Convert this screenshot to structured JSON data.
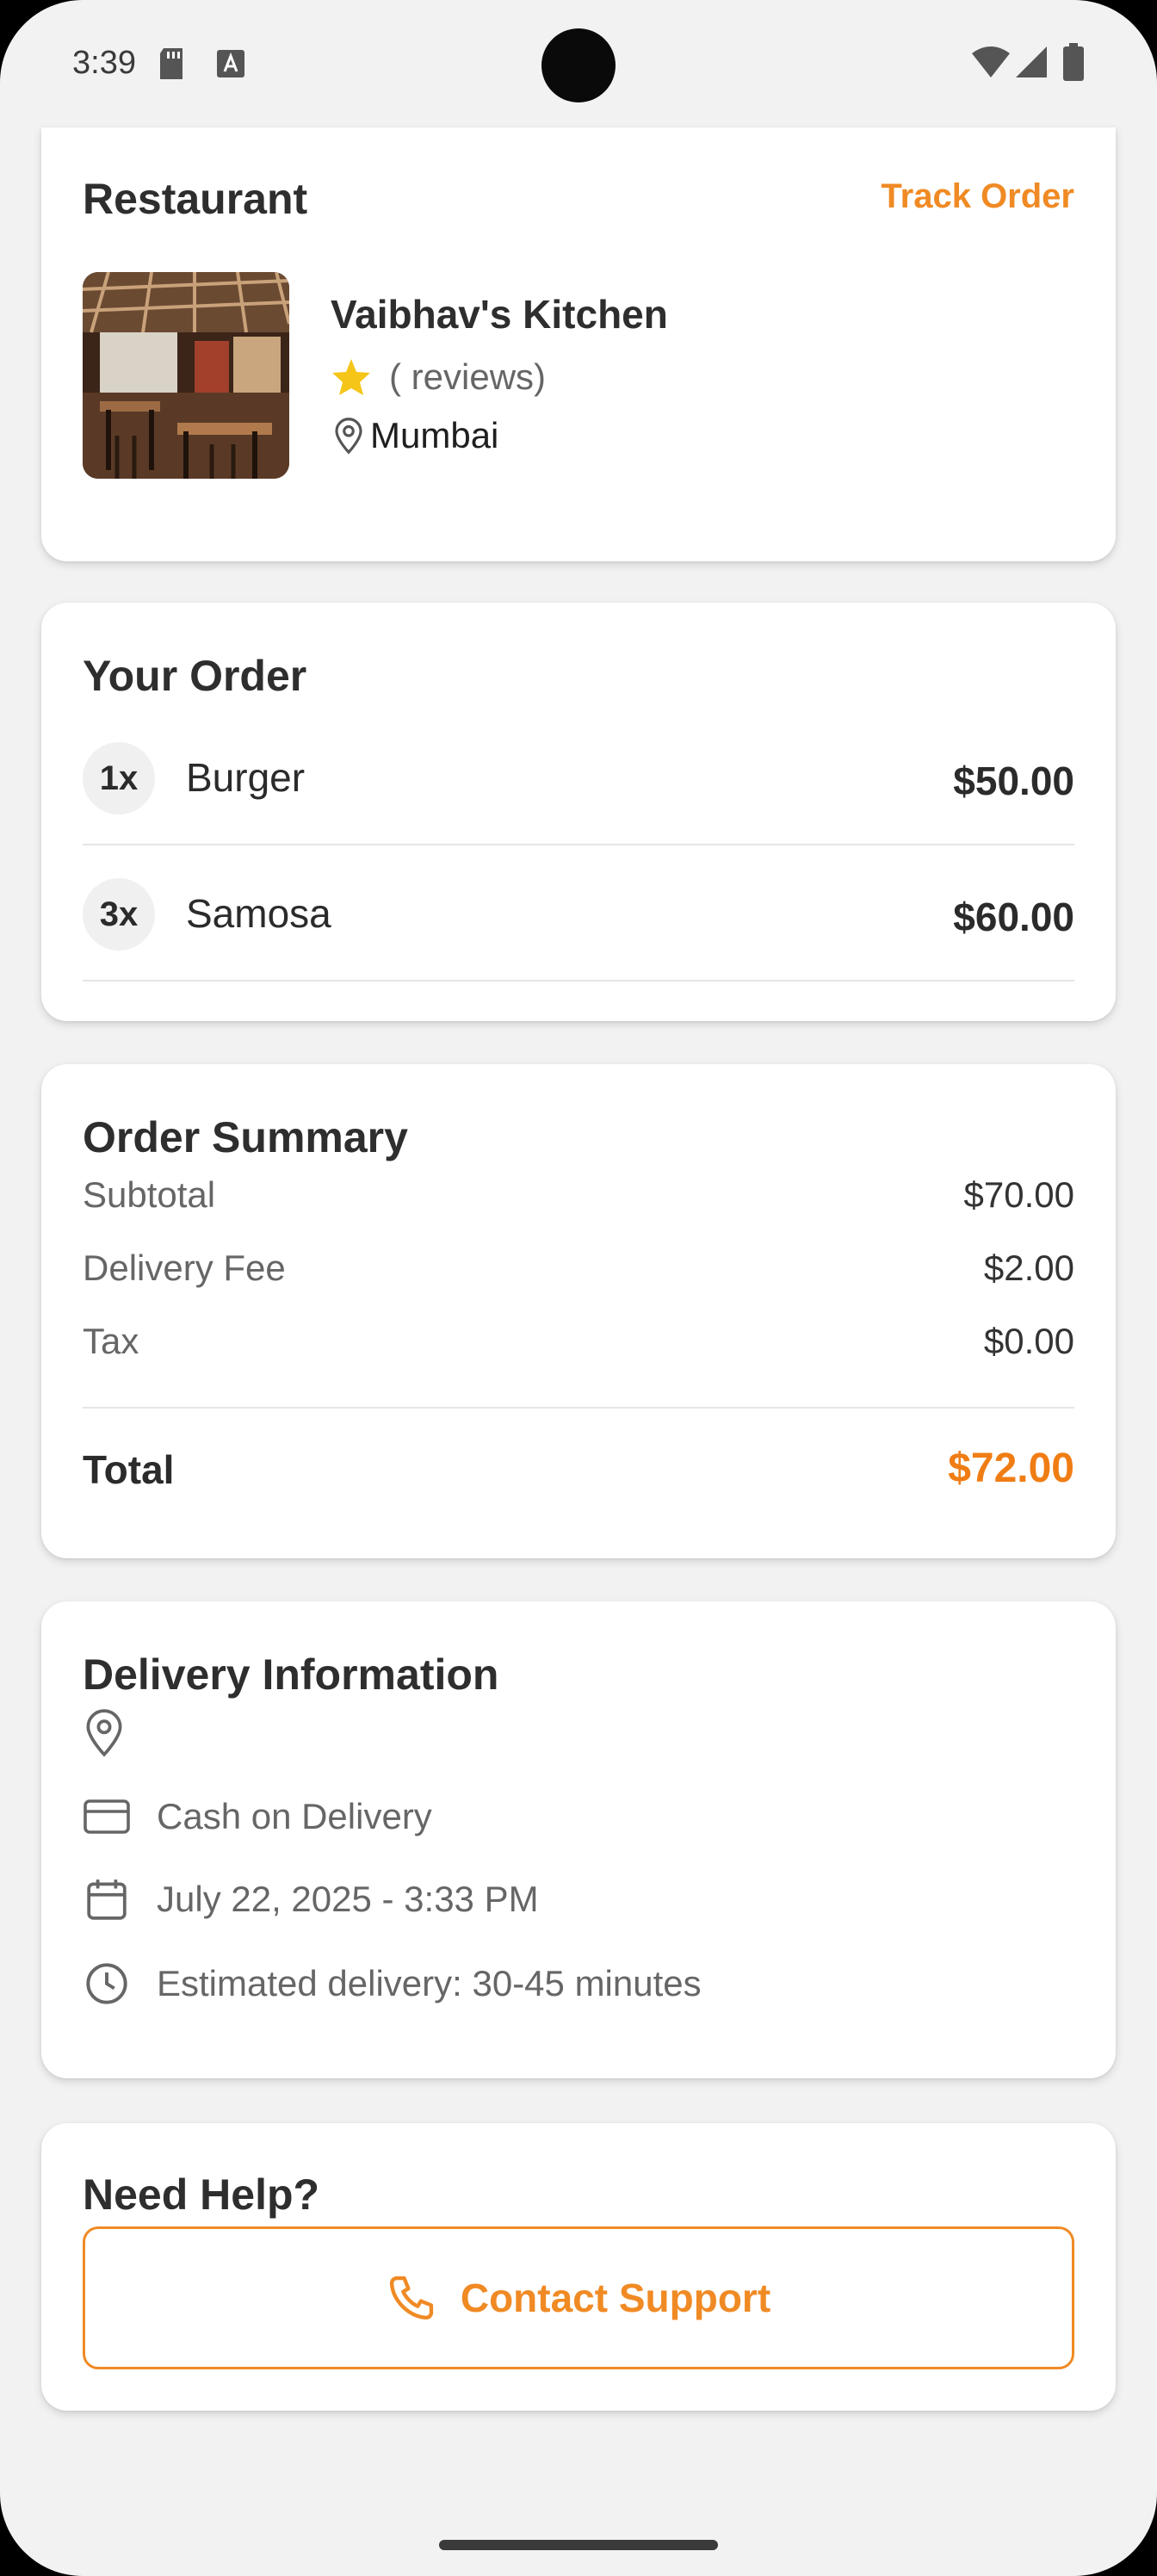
{
  "status_bar": {
    "time": "3:39"
  },
  "restaurant_card": {
    "title": "Restaurant",
    "track_label": "Track Order",
    "name": "Vaibhav's Kitchen",
    "reviews": "( reviews)",
    "location": "Mumbai"
  },
  "order_card": {
    "title": "Your Order",
    "items": [
      {
        "qty": "1x",
        "name": "Burger",
        "price": "$50.00"
      },
      {
        "qty": "3x",
        "name": "Samosa",
        "price": "$60.00"
      }
    ]
  },
  "summary_card": {
    "title": "Order Summary",
    "subtotal_label": "Subtotal",
    "subtotal_value": "$70.00",
    "delivery_label": "Delivery Fee",
    "delivery_value": "$2.00",
    "tax_label": "Tax",
    "tax_value": "$0.00",
    "total_label": "Total",
    "total_value": "$72.00"
  },
  "delivery_card": {
    "title": "Delivery Information",
    "payment": "Cash on Delivery",
    "datetime": "July 22, 2025 - 3:33 PM",
    "estimate": "Estimated delivery: 30-45 minutes"
  },
  "help_card": {
    "title": "Need Help?",
    "button_label": "Contact Support"
  },
  "colors": {
    "accent": "#f08a24",
    "total": "#f07d14",
    "star": "#f5c518"
  }
}
